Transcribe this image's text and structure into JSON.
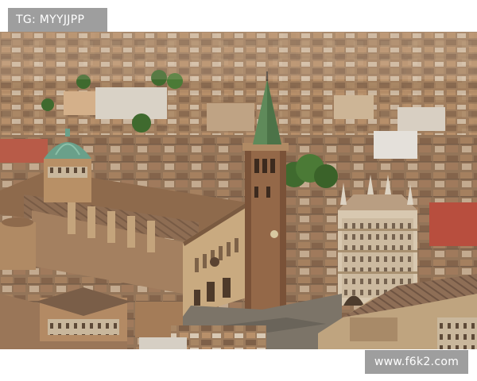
{
  "watermark_top_left": "TG: MYYJJPP",
  "watermark_bottom_right": "www.f6k2.com",
  "photo": {
    "subject": "aerial view of historic city center with cathedral, bell tower with green spire, domed chapel and octagonal baptistery",
    "colors": {
      "roofs": "#8a6a4e",
      "stone": "#b89a74",
      "brick": "#8a5e3e",
      "dome": "#6aa08a",
      "spire": "#5f8a5a",
      "trees": "#3f6a2e",
      "piazza": "#7c7468"
    }
  }
}
